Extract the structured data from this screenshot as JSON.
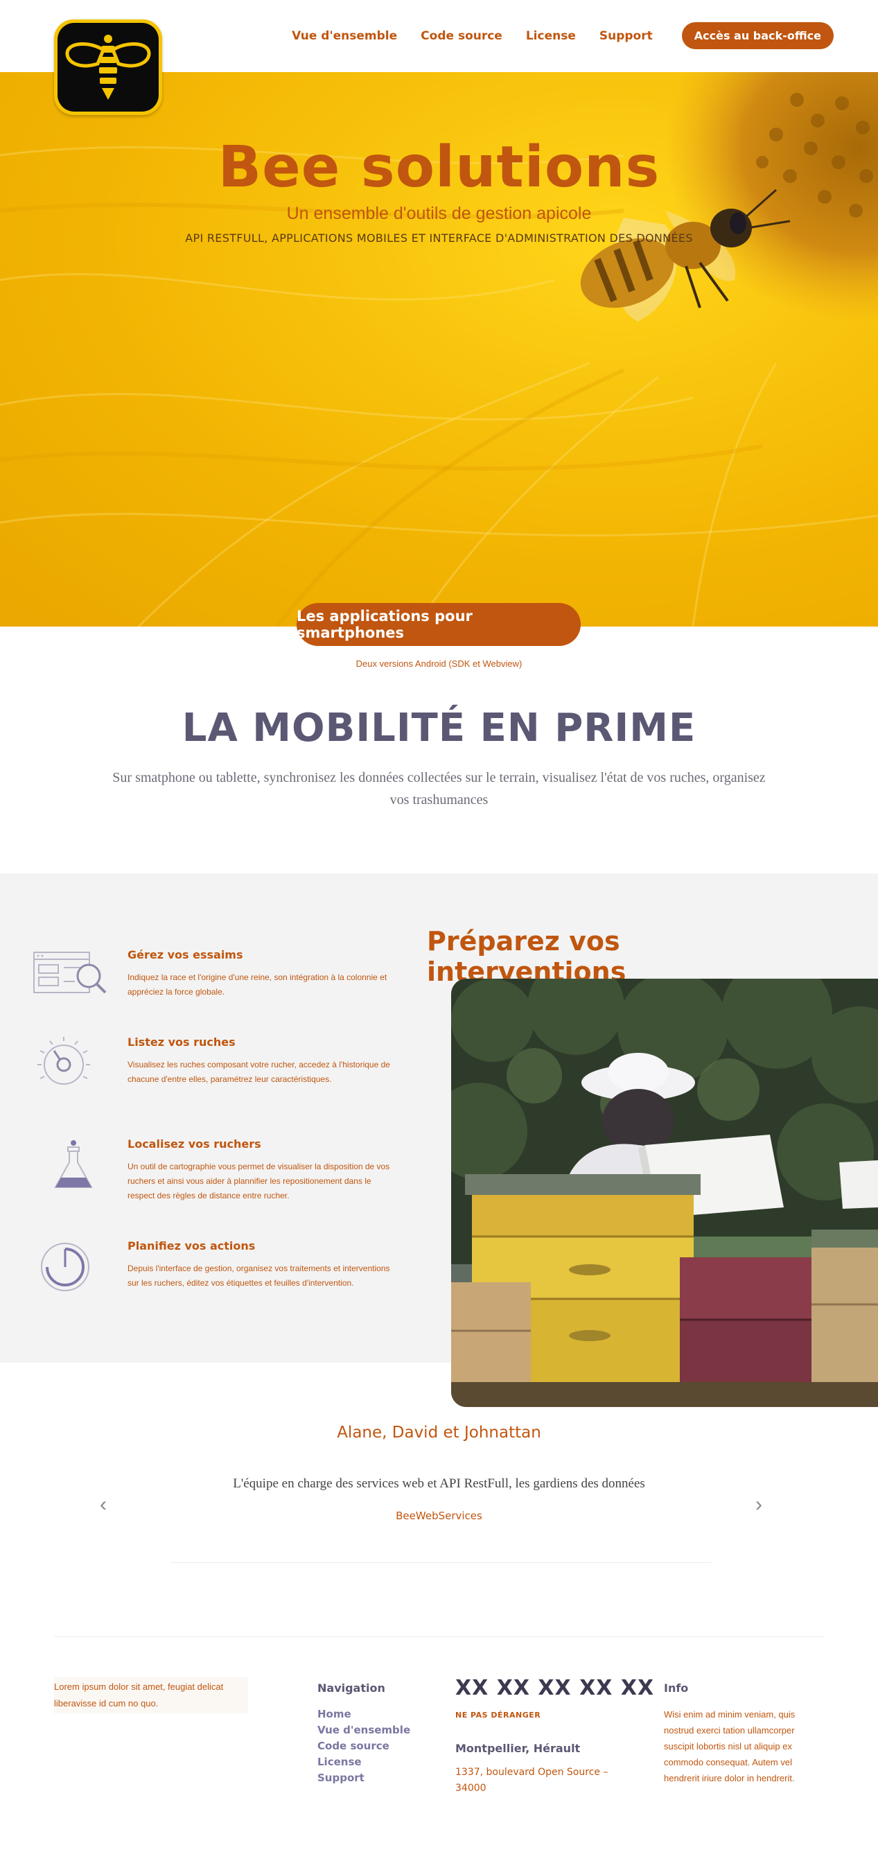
{
  "header": {
    "nav": [
      "Vue d'ensemble",
      "Code source",
      "License",
      "Support"
    ],
    "cta": "Accès au back-office"
  },
  "hero": {
    "title": "Bee solutions",
    "subtitle": "Un ensemble d'outils de gestion apicole",
    "tagline": "API RESTFULL, APPLICATIONS MOBILES ET INTERFACE D'ADMINISTRATION DES DONNÉES"
  },
  "apps": {
    "button": "Les applications pour smartphones",
    "note": "Deux versions Android (SDK et Webview)"
  },
  "mobility": {
    "title": "LA MOBILITÉ EN PRIME",
    "text": "Sur smatphone ou tablette, synchronisez les données collectées sur le terrain, visualisez l'état de vos ruches, organisez vos trashumances"
  },
  "features": [
    {
      "icon": "search-dashboard-icon",
      "title": "Gérez vos essaims",
      "text": "Indiquez la race et l'origine d'une reine, son intégration à la colonnie et appréciez la force globale."
    },
    {
      "icon": "dial-icon",
      "title": "Listez vos ruches",
      "text": "Visualisez les ruches composant votre rucher, accedez à l'historique de chacune d'entre elles, paramétrez leur caractéristiques."
    },
    {
      "icon": "flask-icon",
      "title": "Localisez vos ruchers",
      "text": "Un outil de cartographie vous permet de visualiser la disposition de vos ruchers et ainsi vous aider à plannifier les repositionement dans le respect des règles de distance entre rucher."
    },
    {
      "icon": "timer-icon",
      "title": "Planifiez vos actions",
      "text": "Depuis l'interface de gestion, organisez vos traitements et interventions sur les ruchers, éditez vos étiquettes et feuilles d'intervention."
    }
  ],
  "interventions": {
    "title": "Préparez vos interventions"
  },
  "testimonial": {
    "names": "Alane, David et Johnattan",
    "quote": "L'équipe en charge des services web et API RestFull, les gardiens des données",
    "company": "BeeWebServices"
  },
  "footer": {
    "lorem": "Lorem ipsum dolor sit amet, feugiat delicat liberavisse id cum no quo.",
    "nav_title": "Navigation",
    "nav_items": [
      "Home",
      "Vue d'ensemble",
      "Code source",
      "License",
      "Support"
    ],
    "phone": "XX XX XX XX XX",
    "dnd": "NE PAS DÉRANGER",
    "city": "Montpellier, Hérault",
    "address": "1337, boulevard Open Source – 34000",
    "info_title": "Info",
    "info_text": "Wisi enim ad minim veniam, quis nostrud exerci tation ullamcorper suscipit lobortis nisl ut aliquip ex commodo consequat. Autem vel hendrerit iriure dolor in hendrerit."
  },
  "colors": {
    "accent": "#c0560f",
    "heading": "#5b5874",
    "hero_yellow": "#f5c000"
  }
}
